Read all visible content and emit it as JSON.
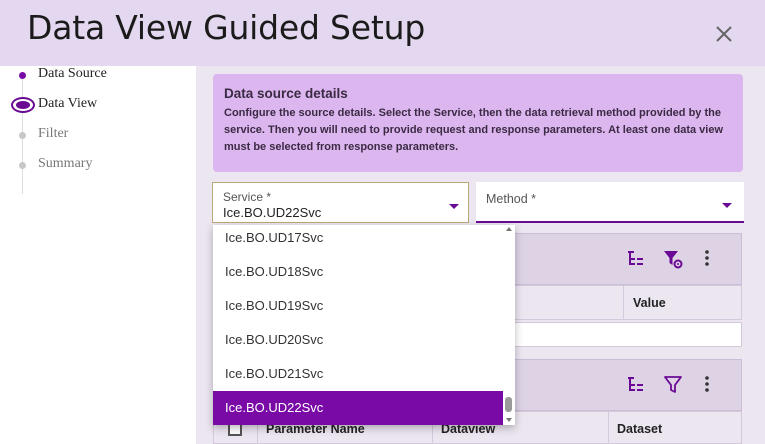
{
  "dialog": {
    "title": "Data View Guided Setup"
  },
  "stepper": {
    "steps": [
      {
        "label": "Data Source",
        "state": "done"
      },
      {
        "label": "Data View",
        "state": "active"
      },
      {
        "label": "Filter",
        "state": "pending"
      },
      {
        "label": "Summary",
        "state": "pending"
      }
    ]
  },
  "info": {
    "title": "Data source details",
    "body": "Configure the source details. Select the Service, then the data retrieval method provided by the service. Then you will need to provide request and response parameters. At least one data view must be selected from response parameters."
  },
  "service": {
    "label": "Service *",
    "value": "Ice.BO.UD22Svc"
  },
  "method": {
    "label": "Method *"
  },
  "dropdown": {
    "options": [
      "Ice.BO.UD17Svc",
      "Ice.BO.UD18Svc",
      "Ice.BO.UD19Svc",
      "Ice.BO.UD20Svc",
      "Ice.BO.UD21Svc",
      "Ice.BO.UD22Svc"
    ],
    "selected": "Ice.BO.UD22Svc"
  },
  "request_grid": {
    "columns": [
      "Value"
    ]
  },
  "response_grid": {
    "columns": [
      "Parameter Name",
      "Dataview",
      "Dataset"
    ]
  },
  "colors": {
    "accent": "#7a0aa6",
    "header_bg": "#e4d8f0",
    "info_bg": "#dcb6ee"
  },
  "icons": [
    "close-icon",
    "tree-view-icon",
    "filter-settings-icon",
    "more-vert-icon",
    "filter-icon",
    "dropdown-caret-icon"
  ]
}
